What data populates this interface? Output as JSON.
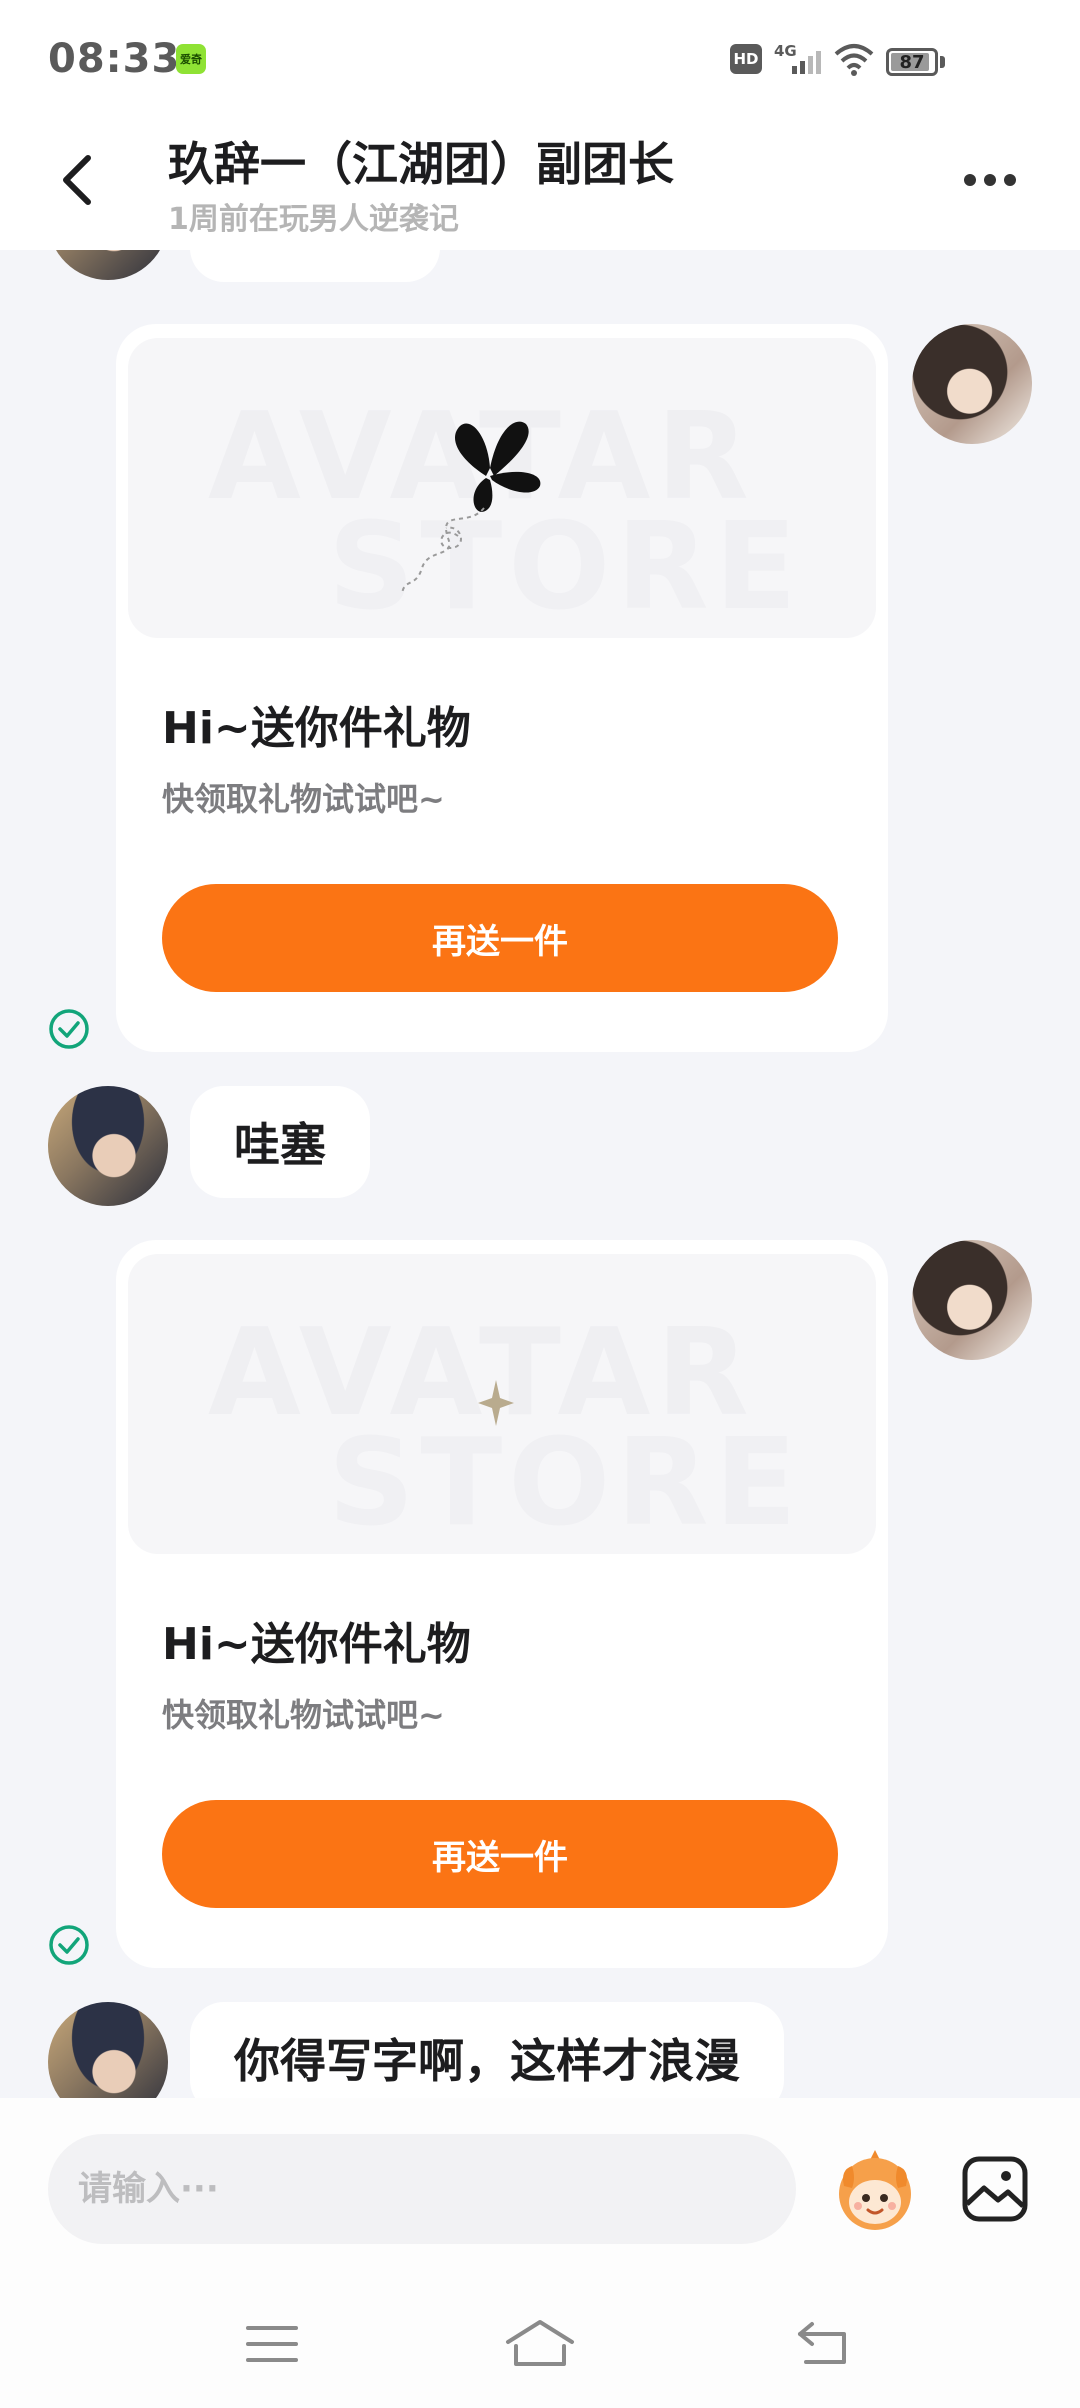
{
  "status_bar": {
    "time": "08:33",
    "app_badge": "爱奇",
    "hd": "HD",
    "network": "4G",
    "battery": "87"
  },
  "header": {
    "title": "玖辞一（江湖团）副团长",
    "subtitle": "1周前在玩男人逆袭记"
  },
  "messages": [
    {
      "type": "gift",
      "side": "right",
      "watermark_line1": "AVATAR",
      "watermark_line2": "STORE",
      "image_icon": "butterfly-icon",
      "title": "Hi~送你件礼物",
      "desc": "快领取礼物试试吧~",
      "button": "再送一件",
      "read": true
    },
    {
      "type": "text",
      "side": "left",
      "text": "哇塞"
    },
    {
      "type": "gift",
      "side": "right",
      "watermark_line1": "AVATAR",
      "watermark_line2": "STORE",
      "image_icon": "sparkle-icon",
      "title": "Hi~送你件礼物",
      "desc": "快领取礼物试试吧~",
      "button": "再送一件",
      "read": true
    },
    {
      "type": "text",
      "side": "left",
      "text": "你得写字啊，这样才浪漫"
    }
  ],
  "input": {
    "placeholder": "请输入···",
    "value": ""
  },
  "icons": {
    "back": "chevron-left-icon",
    "more": "more-dots-icon",
    "emoji": "mascot-emoji-icon",
    "image": "image-icon",
    "read_check": "check-circle-icon",
    "nav_menu": "menu-icon",
    "nav_home": "home-icon",
    "nav_back": "back-icon"
  },
  "colors": {
    "accent": "#fb7414",
    "read_check": "#12a57a",
    "background": "#f4f5f9"
  }
}
